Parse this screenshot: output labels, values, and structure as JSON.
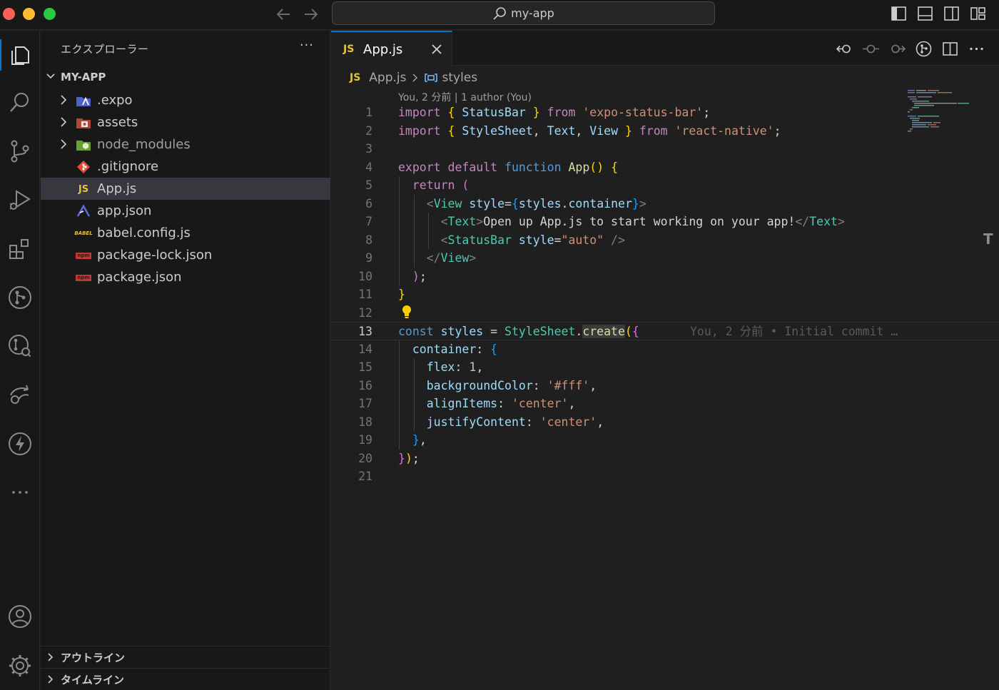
{
  "window": {
    "search_text": "my-app"
  },
  "sidebar": {
    "title": "エクスプローラー",
    "more": "···",
    "root_label": "MY-APP",
    "items": [
      {
        "name": ".expo",
        "type": "folder",
        "icon": "expo-folder-icon"
      },
      {
        "name": "assets",
        "type": "folder",
        "icon": "assets-folder-icon"
      },
      {
        "name": "node_modules",
        "type": "folder",
        "icon": "node-folder-icon"
      },
      {
        "name": ".gitignore",
        "type": "file",
        "icon": "git-icon"
      },
      {
        "name": "App.js",
        "type": "file",
        "icon": "js-icon",
        "badge": "JS"
      },
      {
        "name": "app.json",
        "type": "file",
        "icon": "expo-icon"
      },
      {
        "name": "babel.config.js",
        "type": "file",
        "icon": "babel-icon",
        "badge": "BABEL"
      },
      {
        "name": "package-lock.json",
        "type": "file",
        "icon": "npm-icon",
        "badge": "npm"
      },
      {
        "name": "package.json",
        "type": "file",
        "icon": "npm-icon",
        "badge": "npm"
      }
    ],
    "sections": {
      "outline": "アウトライン",
      "timeline": "タイムライン"
    }
  },
  "editor": {
    "tab": {
      "badge": "JS",
      "label": "App.js"
    },
    "breadcrumb": {
      "file_badge": "JS",
      "file": "App.js",
      "symbol": "styles"
    },
    "blame_header": "You, 2 分前 | 1 author (You)",
    "current_line": 13,
    "inline_blame": "You, 2 分前 • Initial commit …",
    "line_numbers": [
      "1",
      "2",
      "3",
      "4",
      "5",
      "6",
      "7",
      "8",
      "9",
      "10",
      "11",
      "12",
      "13",
      "14",
      "15",
      "16",
      "17",
      "18",
      "19",
      "20",
      "21"
    ]
  },
  "colors": {
    "accent": "#0078d4",
    "js_yellow": "#e8c334",
    "background": "#1f1f1f",
    "sidebar_bg": "#181818"
  }
}
